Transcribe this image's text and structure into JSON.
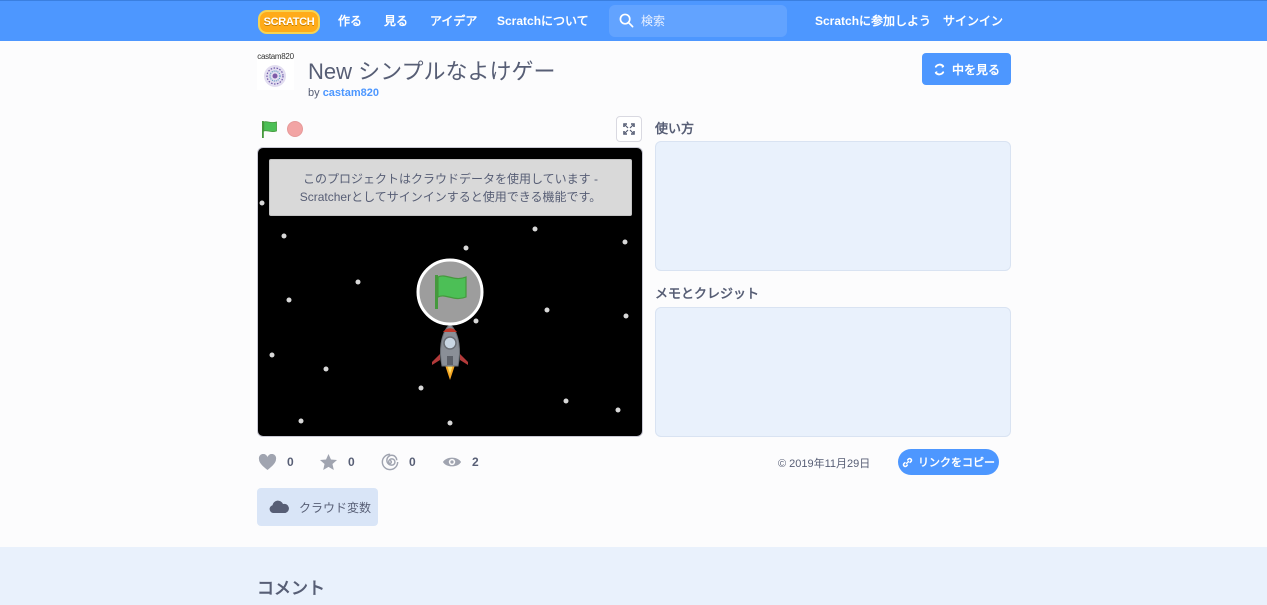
{
  "nav": {
    "logo_text": "SCRATCH",
    "create": "作る",
    "explore": "見る",
    "ideas": "アイデア",
    "about": "Scratchについて",
    "search_placeholder": "検索",
    "join": "Scratchに参加しよう",
    "sign_in": "サインイン"
  },
  "project": {
    "title": "New シンプルなよけゲー",
    "by": "by",
    "author": "castam820",
    "avatar_label": "castam820",
    "see_inside": "中を見る"
  },
  "stage": {
    "cloud_notice_line1": "このプロジェクトはクラウドデータを使用しています -",
    "cloud_notice_line2": "Scratcherとしてサインインすると使用できる機能です。"
  },
  "sidebar": {
    "instructions_title": "使い方",
    "notes_title": "メモとクレジット"
  },
  "stats": {
    "loves": "0",
    "favorites": "0",
    "remixes": "0",
    "views": "2"
  },
  "share_date": "© 2019年11月29日",
  "copy_link": "リンクをコピー",
  "cloud_tag": "クラウド変数",
  "comments_title": "コメント",
  "colors": {
    "brand_blue": "#4d97ff",
    "flag_green": "#4cbf56",
    "stop_red": "#f2a4a4"
  }
}
